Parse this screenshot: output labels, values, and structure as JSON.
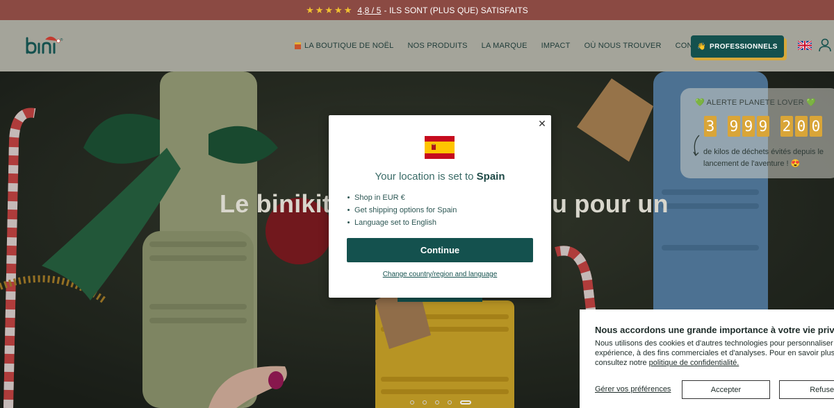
{
  "announcement": {
    "stars": "★★★★★",
    "rating": "4,8 / 5",
    "text": "- ILS SONT (PLUS QUE) SATISFAITS"
  },
  "header": {
    "logo_text": "bini",
    "nav": [
      {
        "label": "LA BOUTIQUE DE NOËL"
      },
      {
        "label": "NOS PRODUITS"
      },
      {
        "label": "LA MARQUE"
      },
      {
        "label": "IMPACT"
      },
      {
        "label": "OÙ NOUS TROUVER"
      },
      {
        "label": "CONTACT"
      }
    ],
    "pro_button": "PROFESSIONNELS",
    "pro_icon": "👋"
  },
  "hero": {
    "title_left": "Le binikit",
    "title_right": "u pour un"
  },
  "counter": {
    "title": "ALERTE PLANETE LOVER",
    "heart": "💚",
    "digits": [
      "3",
      "9",
      "9",
      "9",
      "2",
      "0",
      "0"
    ],
    "description": "de kilos de déchets évités depuis le lancement de l'aventure ! 😍"
  },
  "modal": {
    "heading_prefix": "Your location is set to",
    "country": "Spain",
    "bullets": [
      "Shop in EUR €",
      "Get shipping options for Spain",
      "Language set to English"
    ],
    "continue_label": "Continue",
    "change_label": "Change country/region and language",
    "close_label": "✕"
  },
  "cookie": {
    "title": "Nous accordons une grande importance à votre vie privée",
    "line1": "Nous utilisons des cookies et d'autres technologies pour personnaliser votre",
    "line2": "expérience, à des fins commerciales et d'analyses. Pour en savoir plus,",
    "line3_prefix": "consultez notre",
    "line3_link": "politique de confidentialité.",
    "prefs_label": "Gérer vos préférences",
    "accept_label": "Accepter",
    "refuse_label": "Refuser"
  },
  "colors": {
    "brand_teal": "#14514e",
    "announce_bg": "#8b4a43",
    "header_bg": "#a4a49a",
    "accent_gold": "#d9a538"
  }
}
